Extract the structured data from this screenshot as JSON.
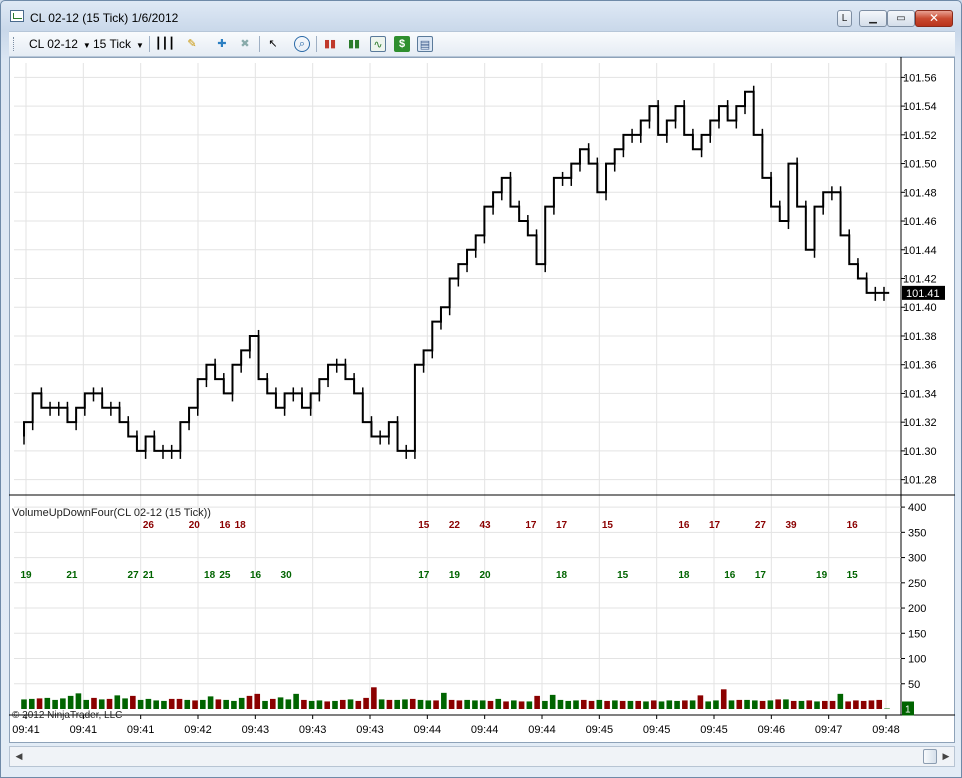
{
  "window": {
    "title": "CL 02-12 (15 Tick)  1/6/2012",
    "buttons": {
      "link": "L",
      "minimize": "▁",
      "maximize": "▭",
      "close": "✕"
    }
  },
  "toolbar": {
    "instrument": "CL 02-12",
    "interval": "15 Tick",
    "icons": [
      "bar-type-icon",
      "drawing-pencil-icon",
      "add-indicator-icon",
      "remove-indicator-icon",
      "cursor-select-icon",
      "zoom-icon",
      "indicators-icon",
      "strategies-icon",
      "chart-properties-icon",
      "data-box-icon",
      "panel-icon"
    ]
  },
  "colors": {
    "up": "#006400",
    "down": "#8b0000",
    "price_line": "#000000",
    "grid": "#e3e3e3",
    "price_marker_bg": "#000000"
  },
  "price_marker": "101.41",
  "volume_marker": "1",
  "copyright": "© 2012 NinjaTrader, LLC",
  "chart_data": [
    {
      "type": "line",
      "title": "",
      "x_ticks": [
        "09:41",
        "09:41",
        "09:41",
        "09:42",
        "09:43",
        "09:43",
        "09:43",
        "09:44",
        "09:44",
        "09:44",
        "09:45",
        "09:45",
        "09:45",
        "09:46",
        "09:47",
        "09:48"
      ],
      "y_ticks": [
        "101.56",
        "101.54",
        "101.52",
        "101.50",
        "101.48",
        "101.46",
        "101.44",
        "101.42",
        "101.40",
        "101.38",
        "101.36",
        "101.34",
        "101.32",
        "101.30",
        "101.28"
      ],
      "ylim": [
        101.27,
        101.57
      ],
      "last_price": 101.41,
      "series": [
        {
          "values": [
            101.31,
            101.32,
            101.34,
            101.33,
            101.33,
            101.33,
            101.32,
            101.33,
            101.34,
            101.34,
            101.33,
            101.33,
            101.32,
            101.31,
            101.3,
            101.31,
            101.3,
            101.3,
            101.3,
            101.32,
            101.33,
            101.35,
            101.36,
            101.35,
            101.34,
            101.36,
            101.37,
            101.38,
            101.35,
            101.34,
            101.33,
            101.34,
            101.34,
            101.33,
            101.34,
            101.35,
            101.36,
            101.36,
            101.35,
            101.34,
            101.32,
            101.31,
            101.31,
            101.32,
            101.3,
            101.3,
            101.36,
            101.37,
            101.39,
            101.4,
            101.42,
            101.43,
            101.44,
            101.45,
            101.47,
            101.48,
            101.49,
            101.47,
            101.46,
            101.45,
            101.43,
            101.47,
            101.49,
            101.49,
            101.5,
            101.51,
            101.5,
            101.48,
            101.5,
            101.51,
            101.52,
            101.52,
            101.53,
            101.54,
            101.52,
            101.53,
            101.54,
            101.52,
            101.51,
            101.52,
            101.53,
            101.54,
            101.53,
            101.54,
            101.55,
            101.52,
            101.49,
            101.47,
            101.46,
            101.5,
            101.47,
            101.44,
            101.47,
            101.48,
            101.48,
            101.45,
            101.43,
            101.42,
            101.41,
            101.41
          ]
        }
      ]
    },
    {
      "type": "bar",
      "title": "VolumeUpDownFour(CL 02-12 (15 Tick))",
      "y_ticks": [
        "400",
        "350",
        "300",
        "250",
        "200",
        "150",
        "100",
        "50"
      ],
      "ylim": [
        0,
        420
      ],
      "up_labels": [
        {
          "text": "19",
          "x": 0
        },
        {
          "text": "21",
          "x": 3
        },
        {
          "text": "27",
          "x": 7
        },
        {
          "text": "21",
          "x": 8
        },
        {
          "text": "18",
          "x": 12
        },
        {
          "text": "25",
          "x": 13
        },
        {
          "text": "16",
          "x": 15
        },
        {
          "text": "30",
          "x": 17
        },
        {
          "text": "17",
          "x": 26
        },
        {
          "text": "19",
          "x": 28
        },
        {
          "text": "20",
          "x": 30
        },
        {
          "text": "18",
          "x": 35
        },
        {
          "text": "15",
          "x": 39
        },
        {
          "text": "18",
          "x": 43
        },
        {
          "text": "16",
          "x": 46
        },
        {
          "text": "17",
          "x": 48
        },
        {
          "text": "19",
          "x": 52
        },
        {
          "text": "15",
          "x": 54
        }
      ],
      "down_labels": [
        {
          "text": "26",
          "x": 8
        },
        {
          "text": "20",
          "x": 11
        },
        {
          "text": "16",
          "x": 13
        },
        {
          "text": "18",
          "x": 14
        },
        {
          "text": "15",
          "x": 26
        },
        {
          "text": "22",
          "x": 28
        },
        {
          "text": "43",
          "x": 30
        },
        {
          "text": "17",
          "x": 33
        },
        {
          "text": "17",
          "x": 35
        },
        {
          "text": "15",
          "x": 38
        },
        {
          "text": "16",
          "x": 43
        },
        {
          "text": "17",
          "x": 45
        },
        {
          "text": "27",
          "x": 48
        },
        {
          "text": "39",
          "x": 50
        },
        {
          "text": "16",
          "x": 54
        }
      ],
      "volumes": [
        {
          "v": 19,
          "up": true
        },
        {
          "v": 20,
          "up": true
        },
        {
          "v": 21,
          "up": false
        },
        {
          "v": 22,
          "up": true
        },
        {
          "v": 18,
          "up": true
        },
        {
          "v": 21,
          "up": true
        },
        {
          "v": 26,
          "up": true
        },
        {
          "v": 31,
          "up": true
        },
        {
          "v": 18,
          "up": true
        },
        {
          "v": 22,
          "up": false
        },
        {
          "v": 19,
          "up": true
        },
        {
          "v": 20,
          "up": false
        },
        {
          "v": 27,
          "up": true
        },
        {
          "v": 21,
          "up": true
        },
        {
          "v": 26,
          "up": false
        },
        {
          "v": 18,
          "up": true
        },
        {
          "v": 20,
          "up": true
        },
        {
          "v": 17,
          "up": true
        },
        {
          "v": 16,
          "up": true
        },
        {
          "v": 20,
          "up": false
        },
        {
          "v": 20,
          "up": false
        },
        {
          "v": 18,
          "up": true
        },
        {
          "v": 17,
          "up": false
        },
        {
          "v": 18,
          "up": true
        },
        {
          "v": 25,
          "up": true
        },
        {
          "v": 19,
          "up": false
        },
        {
          "v": 18,
          "up": true
        },
        {
          "v": 16,
          "up": true
        },
        {
          "v": 22,
          "up": true
        },
        {
          "v": 26,
          "up": false
        },
        {
          "v": 30,
          "up": false
        },
        {
          "v": 16,
          "up": true
        },
        {
          "v": 20,
          "up": false
        },
        {
          "v": 23,
          "up": true
        },
        {
          "v": 19,
          "up": true
        },
        {
          "v": 30,
          "up": true
        },
        {
          "v": 18,
          "up": false
        },
        {
          "v": 16,
          "up": true
        },
        {
          "v": 17,
          "up": true
        },
        {
          "v": 15,
          "up": false
        },
        {
          "v": 16,
          "up": true
        },
        {
          "v": 18,
          "up": false
        },
        {
          "v": 19,
          "up": true
        },
        {
          "v": 16,
          "up": false
        },
        {
          "v": 22,
          "up": false
        },
        {
          "v": 43,
          "up": false
        },
        {
          "v": 19,
          "up": true
        },
        {
          "v": 18,
          "up": false
        },
        {
          "v": 18,
          "up": true
        },
        {
          "v": 19,
          "up": true
        },
        {
          "v": 20,
          "up": false
        },
        {
          "v": 18,
          "up": true
        },
        {
          "v": 17,
          "up": true
        },
        {
          "v": 17,
          "up": false
        },
        {
          "v": 32,
          "up": true
        },
        {
          "v": 18,
          "up": false
        },
        {
          "v": 17,
          "up": false
        },
        {
          "v": 18,
          "up": true
        },
        {
          "v": 17,
          "up": true
        },
        {
          "v": 17,
          "up": true
        },
        {
          "v": 16,
          "up": false
        },
        {
          "v": 20,
          "up": true
        },
        {
          "v": 15,
          "up": false
        },
        {
          "v": 17,
          "up": true
        },
        {
          "v": 15,
          "up": false
        },
        {
          "v": 15,
          "up": true
        },
        {
          "v": 26,
          "up": false
        },
        {
          "v": 16,
          "up": true
        },
        {
          "v": 28,
          "up": true
        },
        {
          "v": 18,
          "up": true
        },
        {
          "v": 16,
          "up": true
        },
        {
          "v": 17,
          "up": true
        },
        {
          "v": 18,
          "up": false
        },
        {
          "v": 16,
          "up": false
        },
        {
          "v": 18,
          "up": true
        },
        {
          "v": 16,
          "up": false
        },
        {
          "v": 17,
          "up": true
        },
        {
          "v": 16,
          "up": false
        },
        {
          "v": 16,
          "up": true
        },
        {
          "v": 16,
          "up": false
        },
        {
          "v": 15,
          "up": true
        },
        {
          "v": 17,
          "up": false
        },
        {
          "v": 15,
          "up": true
        },
        {
          "v": 17,
          "up": true
        },
        {
          "v": 16,
          "up": true
        },
        {
          "v": 17,
          "up": false
        },
        {
          "v": 17,
          "up": true
        },
        {
          "v": 27,
          "up": false
        },
        {
          "v": 15,
          "up": true
        },
        {
          "v": 17,
          "up": true
        },
        {
          "v": 39,
          "up": false
        },
        {
          "v": 17,
          "up": true
        },
        {
          "v": 18,
          "up": false
        },
        {
          "v": 18,
          "up": true
        },
        {
          "v": 17,
          "up": true
        },
        {
          "v": 16,
          "up": false
        },
        {
          "v": 17,
          "up": true
        },
        {
          "v": 19,
          "up": false
        },
        {
          "v": 19,
          "up": true
        },
        {
          "v": 16,
          "up": false
        },
        {
          "v": 16,
          "up": true
        },
        {
          "v": 17,
          "up": false
        },
        {
          "v": 15,
          "up": true
        },
        {
          "v": 16,
          "up": false
        },
        {
          "v": 16,
          "up": false
        },
        {
          "v": 30,
          "up": true
        },
        {
          "v": 15,
          "up": false
        },
        {
          "v": 17,
          "up": false
        },
        {
          "v": 16,
          "up": false
        },
        {
          "v": 17,
          "up": false
        },
        {
          "v": 18,
          "up": false
        },
        {
          "v": 1,
          "up": true
        }
      ]
    }
  ]
}
